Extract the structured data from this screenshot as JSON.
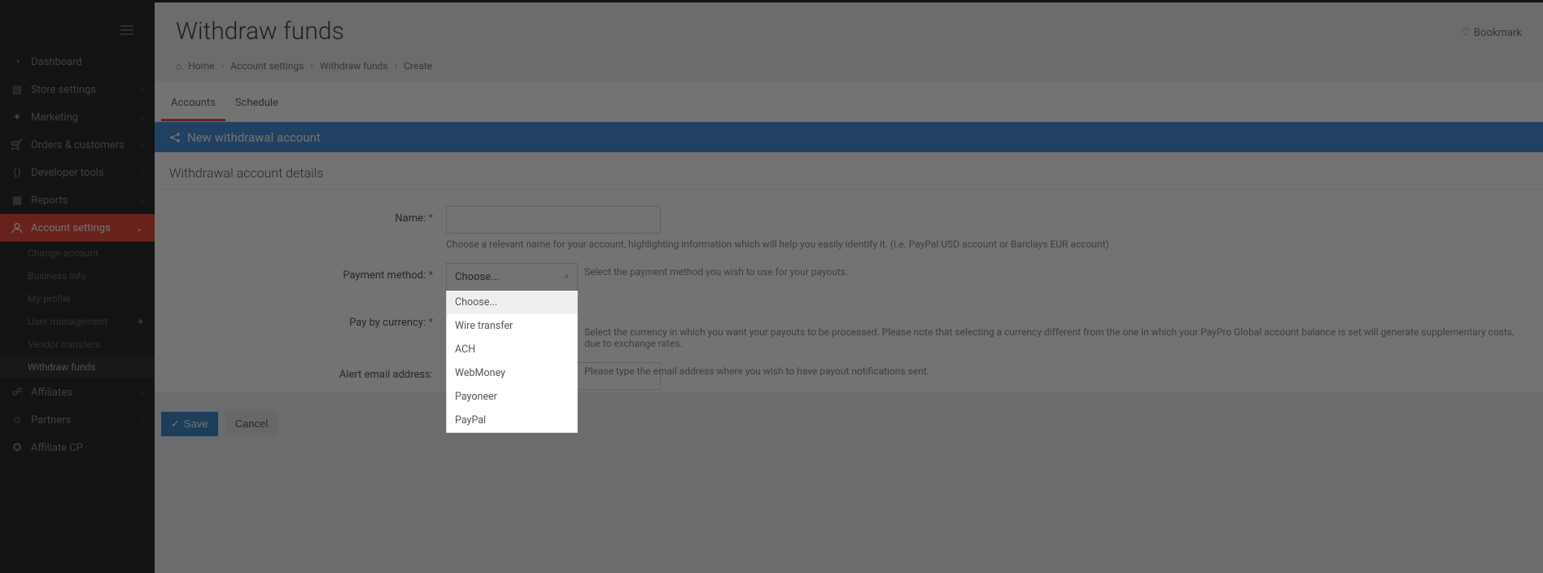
{
  "sidebar": {
    "items": [
      {
        "icon": "gauge",
        "label": "Dashboard"
      },
      {
        "icon": "store",
        "label": "Store settings",
        "caret": true
      },
      {
        "icon": "megaphone",
        "label": "Marketing",
        "caret": true
      },
      {
        "icon": "cart",
        "label": "Orders & customers",
        "caret": true
      },
      {
        "icon": "code",
        "label": "Developer tools",
        "caret": true
      },
      {
        "icon": "report",
        "label": "Reports",
        "caret": true
      },
      {
        "icon": "user",
        "label": "Account settings",
        "caret": true,
        "active": true
      },
      {
        "icon": "link",
        "label": "Affiliates",
        "caret": true
      },
      {
        "icon": "users",
        "label": "Partners",
        "caret": true
      },
      {
        "icon": "badge",
        "label": "Affiliate CP",
        "caret": true
      }
    ],
    "account_sub": [
      {
        "label": "Change account"
      },
      {
        "label": "Business info"
      },
      {
        "label": "My profile"
      },
      {
        "label": "User management",
        "plus": true
      },
      {
        "label": "Vendor transfers"
      },
      {
        "label": "Withdraw funds",
        "active": true
      }
    ]
  },
  "header": {
    "title": "Withdraw funds",
    "bookmark": "Bookmark"
  },
  "breadcrumb": {
    "home": "Home",
    "items": [
      "Account settings",
      "Withdraw funds",
      "Create"
    ]
  },
  "tabs": [
    {
      "label": "Accounts",
      "active": true
    },
    {
      "label": "Schedule"
    }
  ],
  "panel": {
    "title": "New withdrawal account",
    "section": "Withdrawal account details"
  },
  "form": {
    "name": {
      "label": "Name:",
      "value": "",
      "help": "Choose a relevant name for your account, highlighting information which will help you easily identify it. (i.e. PayPal USD account or Barclays EUR account)"
    },
    "method": {
      "label": "Payment method:",
      "selected": "Choose...",
      "help": "Select the payment method you wish to use for your payouts.",
      "options": [
        "Choose...",
        "Wire transfer",
        "ACH",
        "WebMoney",
        "Payoneer",
        "PayPal"
      ]
    },
    "currency": {
      "label": "Pay by currency:",
      "help": "Select the currency in which you want your payouts to be processed. Please note that selecting a currency different from the one in which your PayPro Global account balance is set will generate supplementary costs, due to exchange rates."
    },
    "alert": {
      "label": "Alert email address:",
      "value": "",
      "help": "Please type the email address where you wish to have payout notifications sent."
    }
  },
  "buttons": {
    "save": "Save",
    "cancel": "Cancel"
  }
}
